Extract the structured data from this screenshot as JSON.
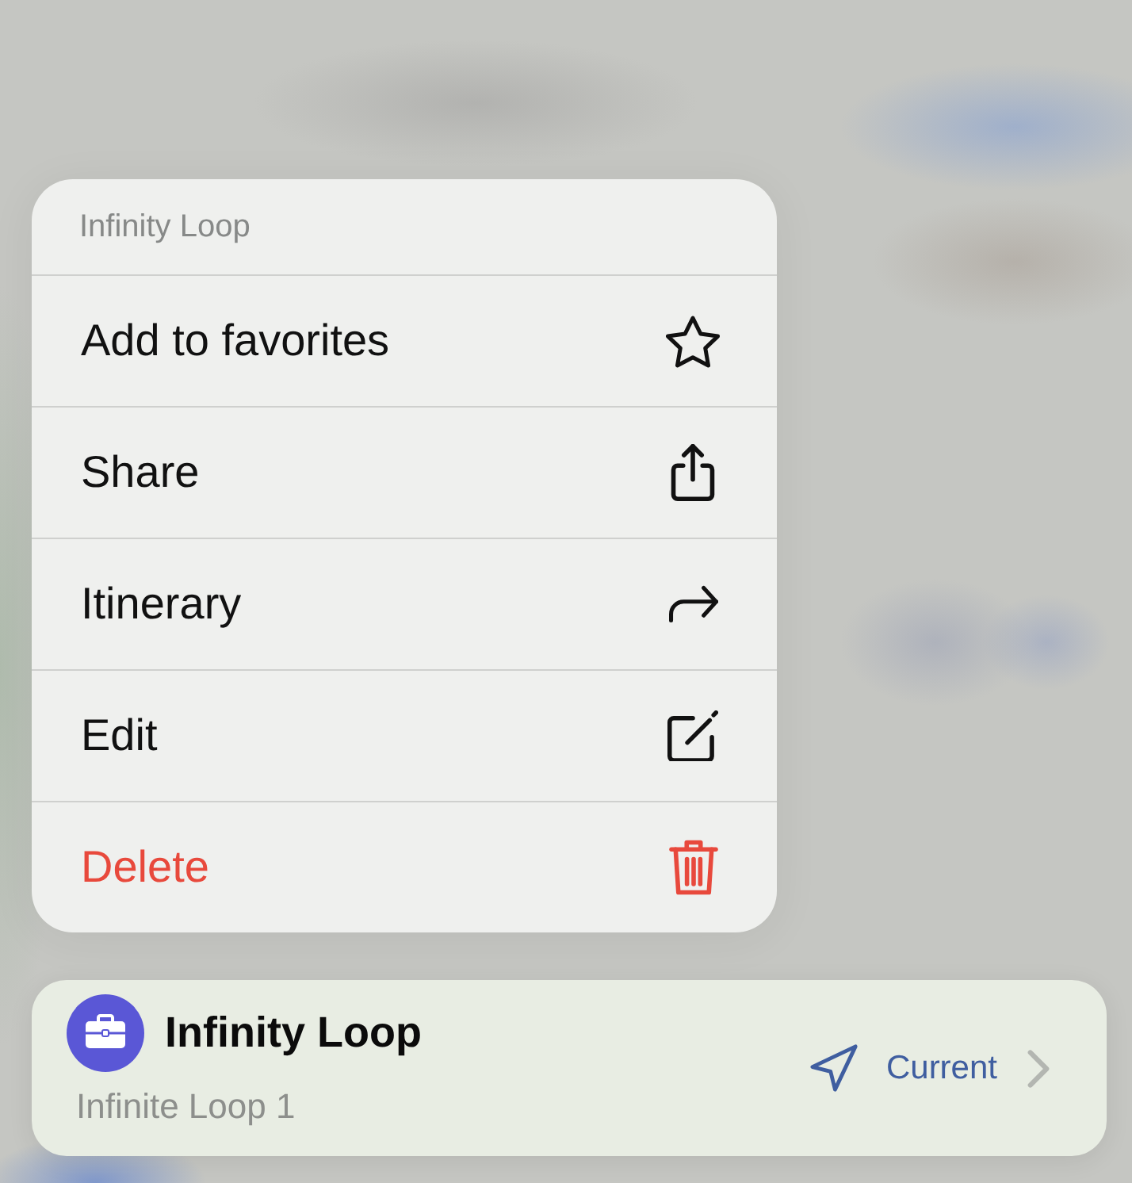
{
  "menu": {
    "title": "Infinity Loop",
    "items": [
      {
        "label": "Add to favorites",
        "destructive": false
      },
      {
        "label": "Share",
        "destructive": false
      },
      {
        "label": "Itinerary",
        "destructive": false
      },
      {
        "label": "Edit",
        "destructive": false
      },
      {
        "label": "Delete",
        "destructive": true
      }
    ]
  },
  "place": {
    "title": "Infinity Loop",
    "address": "Infinite Loop 1",
    "status": "Current"
  }
}
